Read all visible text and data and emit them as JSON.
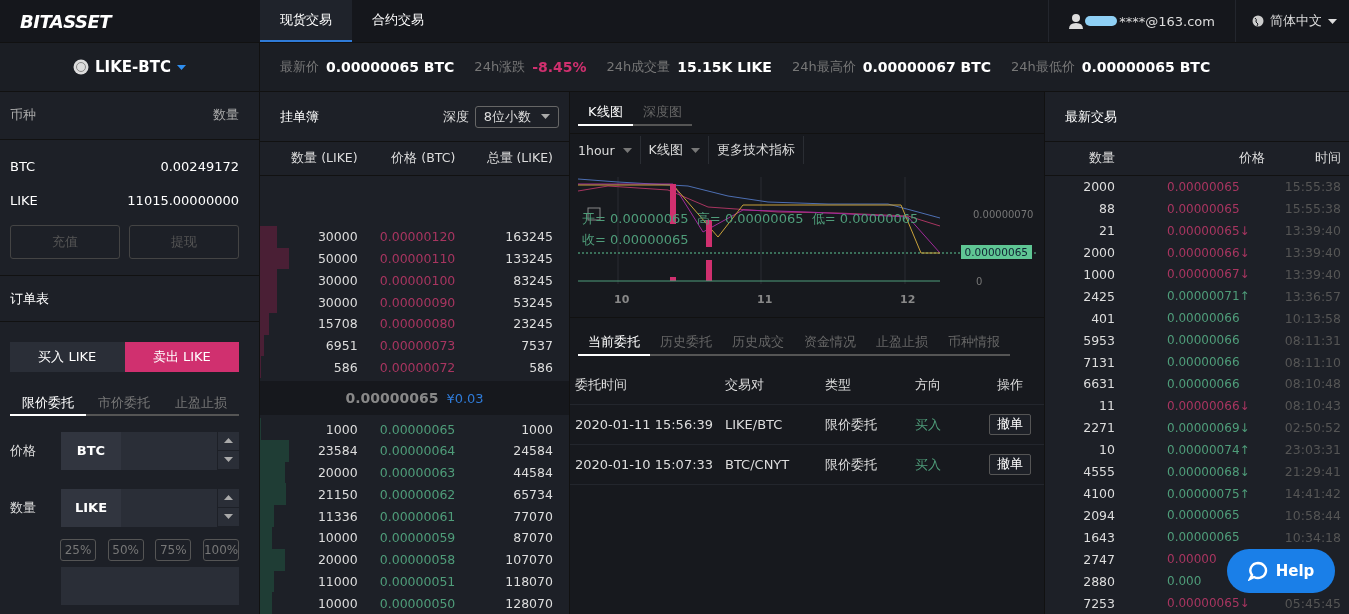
{
  "nav": {
    "logo": "BITASSET",
    "tabs": [
      {
        "label": "现货交易",
        "selected": true
      },
      {
        "label": "合约交易",
        "selected": false
      }
    ],
    "user": "****@163.com",
    "language": "简体中文"
  },
  "ticker": {
    "pair": "LIKE-BTC",
    "stats": [
      {
        "label": "最新价",
        "value": "0.00000065 BTC",
        "kind": "plain"
      },
      {
        "label": "24h涨跌",
        "value": "-8.45%",
        "kind": "down"
      },
      {
        "label": "24h成交量",
        "value": "15.15K LIKE",
        "kind": "plain"
      },
      {
        "label": "24h最高价",
        "value": "0.00000067 BTC",
        "kind": "plain"
      },
      {
        "label": "24h最低价",
        "value": "0.00000065 BTC",
        "kind": "plain"
      }
    ]
  },
  "assets": {
    "headers": [
      "币种",
      "数量"
    ],
    "rows": [
      {
        "coin": "BTC",
        "amount": "0.00249172"
      },
      {
        "coin": "LIKE",
        "amount": "11015.00000000"
      }
    ],
    "buttons": [
      "充值",
      "提现"
    ]
  },
  "order_form": {
    "title": "订单表",
    "sides": [
      {
        "label": "买入 LIKE",
        "selected": false
      },
      {
        "label": "卖出 LIKE",
        "selected": true
      }
    ],
    "tabs": [
      {
        "label": "限价委托",
        "selected": true
      },
      {
        "label": "市价委托",
        "selected": false
      },
      {
        "label": "止盈止损",
        "selected": false
      }
    ],
    "fields": [
      {
        "label": "价格",
        "unit": "BTC"
      },
      {
        "label": "数量",
        "unit": "LIKE"
      }
    ],
    "percents": [
      "25%",
      "50%",
      "75%",
      "100%"
    ]
  },
  "order_book": {
    "title": "挂单簿",
    "depth_label": "深度",
    "depth_value": "8位小数",
    "columns": [
      "数量 (LIKE)",
      "价格 (BTC)",
      "总量 (LIKE)"
    ],
    "asks": [
      {
        "amount": "30000",
        "price": "0.00000120",
        "total": "163245"
      },
      {
        "amount": "50000",
        "price": "0.00000110",
        "total": "133245"
      },
      {
        "amount": "30000",
        "price": "0.00000100",
        "total": "83245"
      },
      {
        "amount": "30000",
        "price": "0.00000090",
        "total": "53245"
      },
      {
        "amount": "15708",
        "price": "0.00000080",
        "total": "23245"
      },
      {
        "amount": "6951",
        "price": "0.00000073",
        "total": "7537"
      },
      {
        "amount": "586",
        "price": "0.00000072",
        "total": "586"
      }
    ],
    "last_price": "0.00000065",
    "last_cny": "¥0.03",
    "bids": [
      {
        "amount": "1000",
        "price": "0.00000065",
        "total": "1000"
      },
      {
        "amount": "23584",
        "price": "0.00000064",
        "total": "24584"
      },
      {
        "amount": "20000",
        "price": "0.00000063",
        "total": "44584"
      },
      {
        "amount": "21150",
        "price": "0.00000062",
        "total": "65734"
      },
      {
        "amount": "11336",
        "price": "0.00000061",
        "total": "77070"
      },
      {
        "amount": "10000",
        "price": "0.00000059",
        "total": "87070"
      },
      {
        "amount": "20000",
        "price": "0.00000058",
        "total": "107070"
      },
      {
        "amount": "11000",
        "price": "0.00000051",
        "total": "118070"
      },
      {
        "amount": "10000",
        "price": "0.00000050",
        "total": "128070"
      }
    ]
  },
  "chart": {
    "tabs": [
      {
        "label": "K线图",
        "selected": true
      },
      {
        "label": "深度图",
        "selected": false
      }
    ],
    "tools": [
      {
        "label": "1hour",
        "kind": "dropdown"
      },
      {
        "label": "K线图",
        "kind": "dropdown"
      },
      {
        "label": "更多技术指标",
        "kind": "button"
      }
    ],
    "legend": [
      "开= 0.00000065  高= 0.00000065  低= 0.00000065",
      "收= 0.00000065"
    ],
    "y_labels": [
      "0.00000070",
      "0"
    ],
    "current_price": "0.00000065",
    "x_labels": [
      "10",
      "11",
      "12"
    ]
  },
  "orders": {
    "tabs": [
      {
        "label": "当前委托",
        "selected": true
      },
      {
        "label": "历史委托",
        "selected": false
      },
      {
        "label": "历史成交",
        "selected": false
      },
      {
        "label": "资金情况",
        "selected": false
      },
      {
        "label": "止盈止损",
        "selected": false
      },
      {
        "label": "币种情报",
        "selected": false
      }
    ],
    "columns": [
      "委托时间",
      "交易对",
      "类型",
      "方向",
      "操作"
    ],
    "rows": [
      {
        "time": "2020-01-11 15:56:39",
        "pair": "LIKE/BTC",
        "type": "限价委托",
        "color": "#4f9d7a",
        "direction": "买入",
        "action": "撤单"
      },
      {
        "time": "2020-01-10 15:07:33",
        "pair": "BTC/CNYT",
        "type": "限价委托",
        "color": "#4f9d7a",
        "direction": "买入",
        "action": "撤单"
      }
    ]
  },
  "trades": {
    "title": "最新交易",
    "columns": [
      "数量",
      "价格",
      "时间"
    ],
    "rows": [
      {
        "amount": "2000",
        "price": "0.00000065",
        "time": "15:55:38",
        "color": "#a83560"
      },
      {
        "amount": "88",
        "price": "0.00000065",
        "time": "15:55:38",
        "color": "#a83560"
      },
      {
        "amount": "21",
        "price": "0.00000065↓",
        "time": "13:39:40",
        "color": "#a83560"
      },
      {
        "amount": "2000",
        "price": "0.00000066↓",
        "time": "13:39:40",
        "color": "#a83560"
      },
      {
        "amount": "1000",
        "price": "0.00000067↓",
        "time": "13:39:40",
        "color": "#a83560"
      },
      {
        "amount": "2425",
        "price": "0.00000071↑",
        "time": "13:36:57",
        "color": "#4f9d7a"
      },
      {
        "amount": "401",
        "price": "0.00000066",
        "time": "10:13:58",
        "color": "#4f9d7a"
      },
      {
        "amount": "5953",
        "price": "0.00000066",
        "time": "08:11:31",
        "color": "#4f9d7a"
      },
      {
        "amount": "7131",
        "price": "0.00000066",
        "time": "08:11:10",
        "color": "#4f9d7a"
      },
      {
        "amount": "6631",
        "price": "0.00000066",
        "time": "08:10:48",
        "color": "#4f9d7a"
      },
      {
        "amount": "11",
        "price": "0.00000066↓",
        "time": "08:10:43",
        "color": "#a83560"
      },
      {
        "amount": "2271",
        "price": "0.00000069↓",
        "time": "02:50:52",
        "color": "#4f9d7a"
      },
      {
        "amount": "10",
        "price": "0.00000074↑",
        "time": "23:03:31",
        "color": "#4f9d7a"
      },
      {
        "amount": "4555",
        "price": "0.00000068↓",
        "time": "21:29:41",
        "color": "#4f9d7a"
      },
      {
        "amount": "4100",
        "price": "0.00000075↑",
        "time": "14:41:42",
        "color": "#4f9d7a"
      },
      {
        "amount": "2094",
        "price": "0.00000065",
        "time": "10:58:44",
        "color": "#4f9d7a"
      },
      {
        "amount": "1643",
        "price": "0.00000065",
        "time": "10:34:18",
        "color": "#4f9d7a"
      },
      {
        "amount": "2747",
        "price": "0.00000",
        "color": "#a83560"
      },
      {
        "amount": "2880",
        "price": "0.000",
        "color": "#4f9d7a"
      },
      {
        "amount": "7253",
        "price": "0.00000065↓",
        "time": "05:45:45",
        "color": "#a83560"
      }
    ]
  },
  "help": {
    "label": "Help"
  }
}
